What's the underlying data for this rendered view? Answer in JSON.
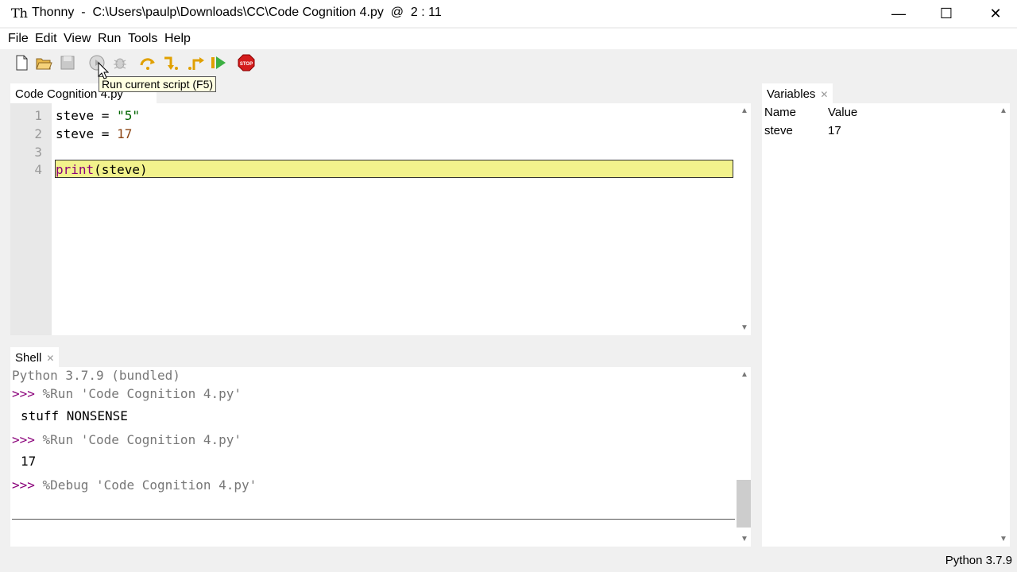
{
  "window": {
    "app_name": "Thonny",
    "separator": "-",
    "path": "C:\\Users\\paulp\\Downloads\\CC\\Code Cognition 4.py",
    "cursor_pos": "@  2 : 11",
    "minimize": "—",
    "maximize": "☐",
    "close": "✕"
  },
  "menu": [
    "File",
    "Edit",
    "View",
    "Run",
    "Tools",
    "Help"
  ],
  "toolbar": {
    "tooltip": "Run current script (F5)",
    "stop_label": "STOP"
  },
  "editor": {
    "tab_label": "Code Cognition 4.py",
    "lines": [
      {
        "num": "1",
        "var": "steve",
        "op": " = ",
        "val": "\"5\""
      },
      {
        "num": "2",
        "var": "steve",
        "op": " = ",
        "val": "17"
      },
      {
        "num": "3"
      },
      {
        "num": "4",
        "func": "print",
        "args": "(steve)"
      }
    ]
  },
  "shell": {
    "tab_label": "Shell",
    "banner": "Python 3.7.9 (bundled)",
    "prompt": ">>>",
    "cmd1": " %Run 'Code Cognition 4.py'",
    "out1": "stuff NONSENSE",
    "cmd2": " %Run 'Code Cognition 4.py'",
    "out2": "17",
    "cmd3": " %Debug 'Code Cognition 4.py'"
  },
  "variables": {
    "tab_label": "Variables",
    "col_name": "Name",
    "col_value": "Value",
    "rows": [
      {
        "name": "steve",
        "value": "17"
      }
    ]
  },
  "statusbar": {
    "interpreter": "Python 3.7.9"
  },
  "colors": {
    "line_highlight": "#f2f28c",
    "prompt": "#8a007a",
    "string": "#006400",
    "number": "#8b4513"
  }
}
